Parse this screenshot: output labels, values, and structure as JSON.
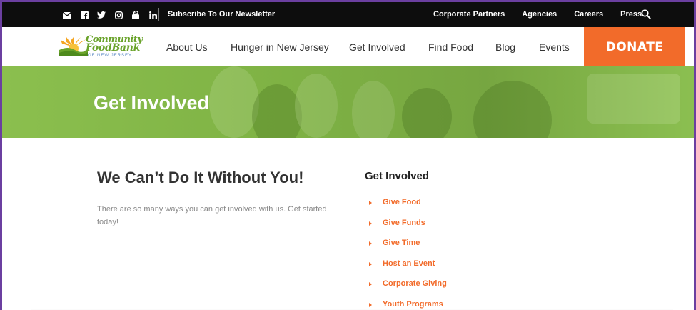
{
  "topbar": {
    "social_icons": [
      "mail-icon",
      "facebook-icon",
      "twitter-icon",
      "instagram-icon",
      "youtube-icon",
      "linkedin-icon"
    ],
    "newsletter": "Subscribe To Our Newsletter",
    "links": [
      "Corporate Partners",
      "Agencies",
      "Careers",
      "Press"
    ],
    "search_icon": "search-icon"
  },
  "logo": {
    "line1": "Community",
    "line2": "FoodBank",
    "line3": "OF NEW JERSEY"
  },
  "nav": {
    "items": [
      "About Us",
      "Hunger in New Jersey",
      "Get Involved",
      "Find Food",
      "Blog",
      "Events"
    ],
    "donate": "DONATE"
  },
  "hero": {
    "title": "Get Involved"
  },
  "main": {
    "heading": "We Can’t Do It Without You!",
    "body": "There are so many ways you can get involved with us. Get started today!"
  },
  "sidebar": {
    "title": "Get Involved",
    "items": [
      "Give Food",
      "Give Funds",
      "Give Time",
      "Host an Event",
      "Corporate Giving",
      "Youth Programs"
    ]
  },
  "colors": {
    "accent": "#f26b2a",
    "brand_green": "#6aa32b",
    "hero_green": "#8bbf4e",
    "topbar": "#0d0d0d"
  }
}
